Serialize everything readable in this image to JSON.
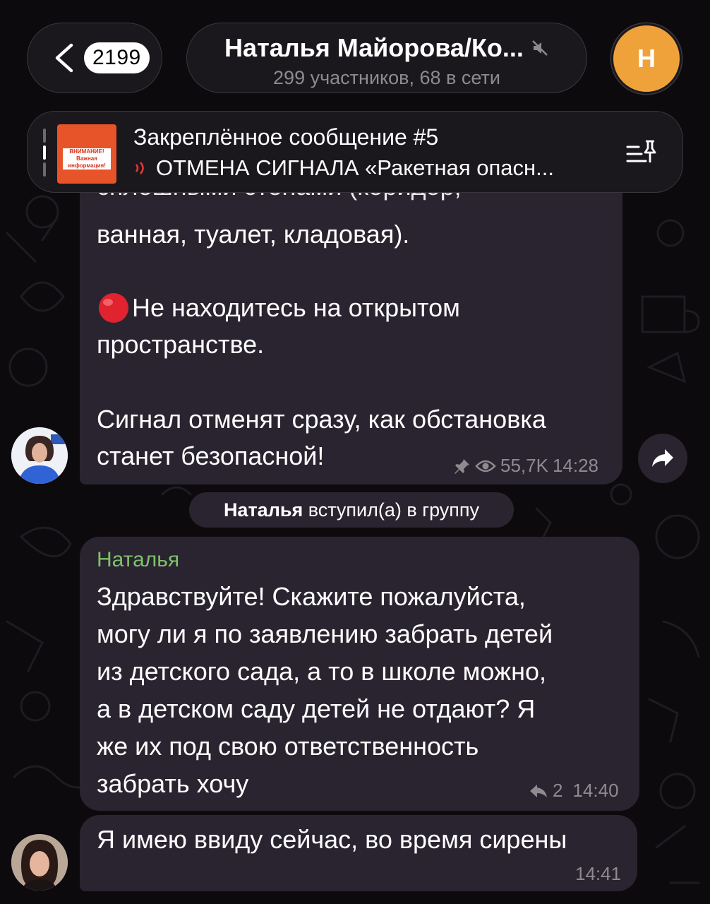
{
  "header": {
    "back_count": "2199",
    "title": "Наталья Майорова/Ко...",
    "subtitle": "299 участников, 68 в сети",
    "avatar_letter": "Н",
    "colors": {
      "avatar": "#f0a23a",
      "pill": "#1b181d"
    }
  },
  "pinned": {
    "title": "Закреплённое сообщение #5",
    "text": "ОТМЕНА СИГНАЛА «Ракетная опасн...",
    "thumb_label": "ВНИМАНИЕ! Важная информация!",
    "icons": {
      "sound": "sound-wave-icon",
      "unpin": "pin-list-icon"
    }
  },
  "messages": {
    "m1": {
      "cut_line": "сплошными стенами (коридор,",
      "line1": "ванная, туалет, кладовая).",
      "line2": "Не находитесь на открытом",
      "line3": "пространстве.",
      "line4": "Сигнал отменят сразу, как обстановка",
      "line5": "станет безопасной!",
      "views": "55,7K",
      "time": "14:28",
      "icons": {
        "pin": "pin-icon",
        "views": "eye-icon",
        "emoji": "red-circle"
      }
    },
    "service": {
      "name": "Наталья",
      "action": "вступил(а) в группу"
    },
    "m2": {
      "sender": "Наталья",
      "text": "Здравствуйте! Скажите пожалуйста,\nмогу ли я по заявлению забрать детей\nиз детского сада,  а то в школе можно,\nа в детском саду детей не отдают? Я\nже их под свою ответственность\nзабрать хочу",
      "replies": "2",
      "time": "14:40",
      "colors": {
        "sender": "#7ec16b"
      }
    },
    "m3": {
      "text": "Я имею ввиду сейчас, во время сирены",
      "time": "14:41"
    }
  }
}
